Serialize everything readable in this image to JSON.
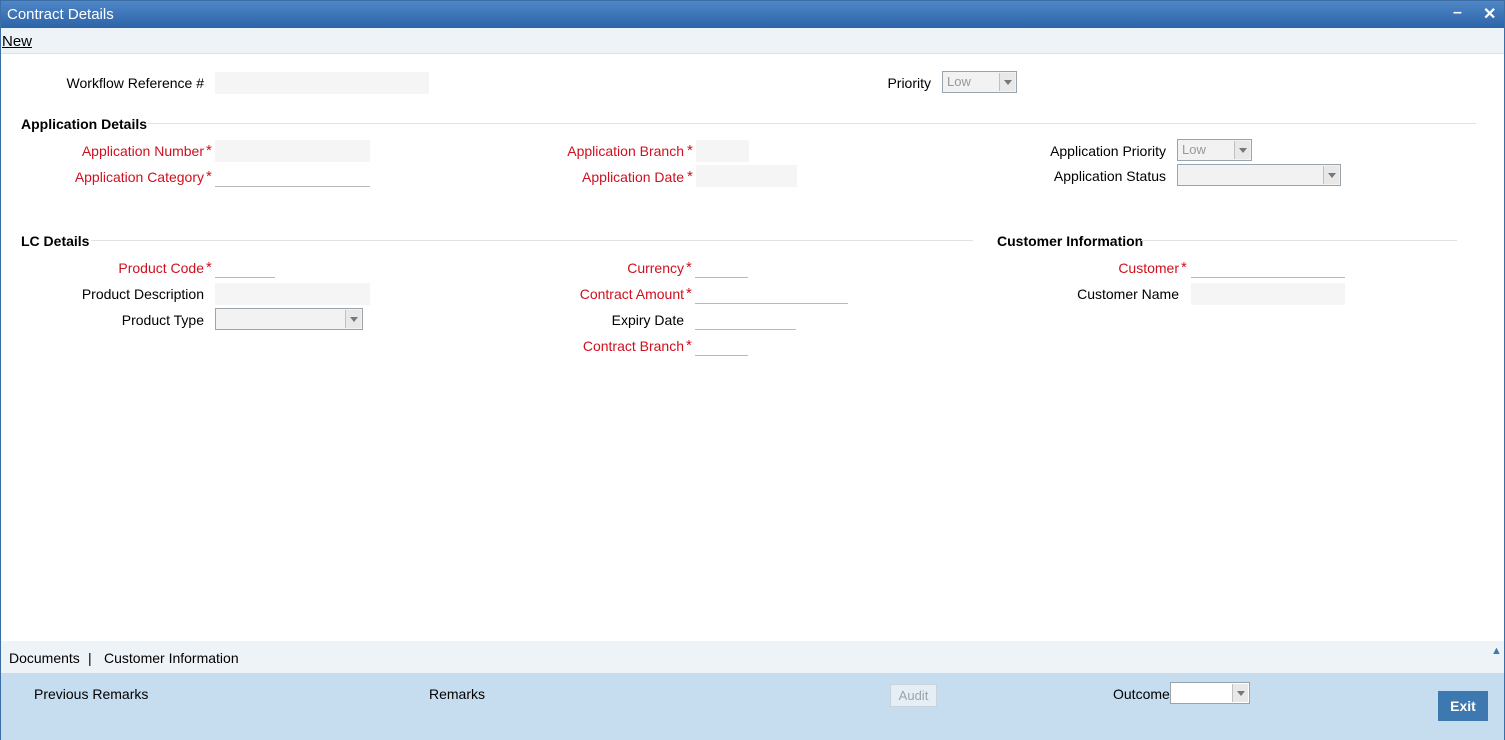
{
  "window": {
    "title": "Contract Details",
    "minimize": "–",
    "close": "✕"
  },
  "menu": {
    "new_label": "New"
  },
  "header": {
    "workflow_ref_label": "Workflow Reference #",
    "workflow_ref_value": "",
    "priority_label": "Priority",
    "priority_value": "Low"
  },
  "application_details": {
    "title": "Application Details",
    "application_number_label": "Application Number",
    "application_category_label": "Application Category",
    "application_branch_label": "Application Branch",
    "application_date_label": "Application Date",
    "application_priority_label": "Application Priority",
    "application_priority_value": "Low",
    "application_status_label": "Application Status",
    "application_status_value": ""
  },
  "lc_details": {
    "title": "LC Details",
    "product_code_label": "Product Code",
    "product_description_label": "Product Description",
    "product_type_label": "Product Type",
    "product_type_value": "",
    "currency_label": "Currency",
    "contract_amount_label": "Contract Amount",
    "expiry_date_label": "Expiry Date",
    "contract_branch_label": "Contract Branch"
  },
  "customer_information": {
    "title": "Customer Information",
    "customer_label": "Customer",
    "customer_name_label": "Customer Name"
  },
  "required_marker": "*",
  "tabs": {
    "documents": "Documents",
    "separator": "|",
    "customer_information": "Customer Information"
  },
  "footer": {
    "previous_remarks": "Previous Remarks",
    "remarks": "Remarks",
    "audit": "Audit",
    "outcome_label": "Outcome",
    "outcome_value": "",
    "exit": "Exit"
  },
  "colors": {
    "title_bar": "#2c64a8",
    "required": "#d0101e",
    "footer_bg": "#c6ddf0",
    "exit_button": "#3d78b0"
  },
  "icons": {
    "dropdown": "chevron-down-icon",
    "scroll_up": "chevron-up-icon"
  }
}
